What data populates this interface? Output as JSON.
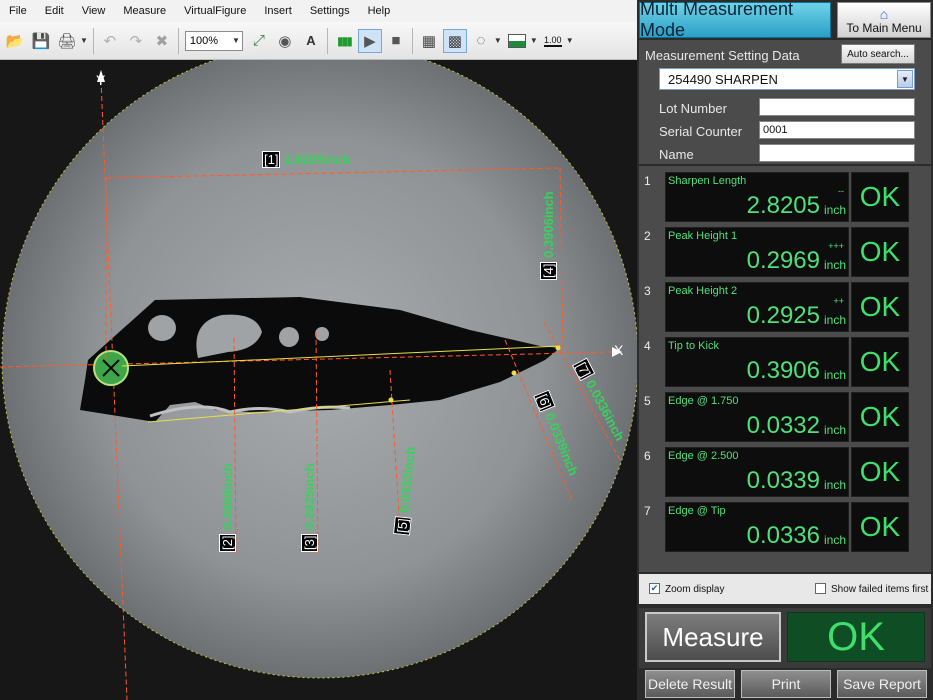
{
  "menubar": {
    "items": [
      "File",
      "Edit",
      "View",
      "Measure",
      "VirtualFigure",
      "Insert",
      "Settings",
      "Help"
    ]
  },
  "toolbar": {
    "zoom": "100%",
    "line_width": "1.00"
  },
  "image": {
    "axis_x_label": "X",
    "axis_y_label": "Y",
    "measurements": [
      {
        "num": "[1]",
        "text": "2.8205inch"
      },
      {
        "num": "[2]",
        "text": "0.2969inch"
      },
      {
        "num": "[3]",
        "text": "0.2925inch"
      },
      {
        "num": "[4]",
        "text": "0.3906inch"
      },
      {
        "num": "[5]",
        "text": "0.0332inch"
      },
      {
        "num": "[6]",
        "text": "0.0339inch"
      },
      {
        "num": "[7]",
        "text": "0.0336inch"
      }
    ]
  },
  "panel": {
    "mode_title": "Multi Measurement Mode",
    "main_menu_label": "To Main Menu",
    "setting_title": "Measurement Setting Data",
    "auto_search_label": "Auto search...",
    "setting_selected": "254490 SHARPEN",
    "fields": [
      {
        "label": "Lot Number",
        "value": ""
      },
      {
        "label": "Serial Counter",
        "value": "0001"
      },
      {
        "label": "Name",
        "value": ""
      }
    ],
    "results": [
      {
        "index": "1",
        "label": "Sharpen Length",
        "sign": "--",
        "value": "2.8205",
        "unit": "inch",
        "judge": "OK"
      },
      {
        "index": "2",
        "label": "Peak Height 1",
        "sign": "+++",
        "value": "0.2969",
        "unit": "inch",
        "judge": "OK"
      },
      {
        "index": "3",
        "label": "Peak Height 2",
        "sign": "++",
        "value": "0.2925",
        "unit": "inch",
        "judge": "OK"
      },
      {
        "index": "4",
        "label": "Tip to Kick",
        "sign": "",
        "value": "0.3906",
        "unit": "inch",
        "judge": "OK"
      },
      {
        "index": "5",
        "label": "Edge @ 1.750",
        "sign": "",
        "value": "0.0332",
        "unit": "inch",
        "judge": "OK"
      },
      {
        "index": "6",
        "label": "Edge @ 2.500",
        "sign": "",
        "value": "0.0339",
        "unit": "inch",
        "judge": "OK"
      },
      {
        "index": "7",
        "label": "Edge @ Tip",
        "sign": "",
        "value": "0.0336",
        "unit": "inch",
        "judge": "OK"
      }
    ],
    "zoom_display_label": "Zoom display",
    "zoom_display_checked": true,
    "show_failed_label": "Show failed items first",
    "show_failed_checked": false,
    "measure_label": "Measure",
    "total_judge": "OK",
    "delete_label": "Delete Result",
    "print_label": "Print",
    "save_label": "Save Report"
  }
}
